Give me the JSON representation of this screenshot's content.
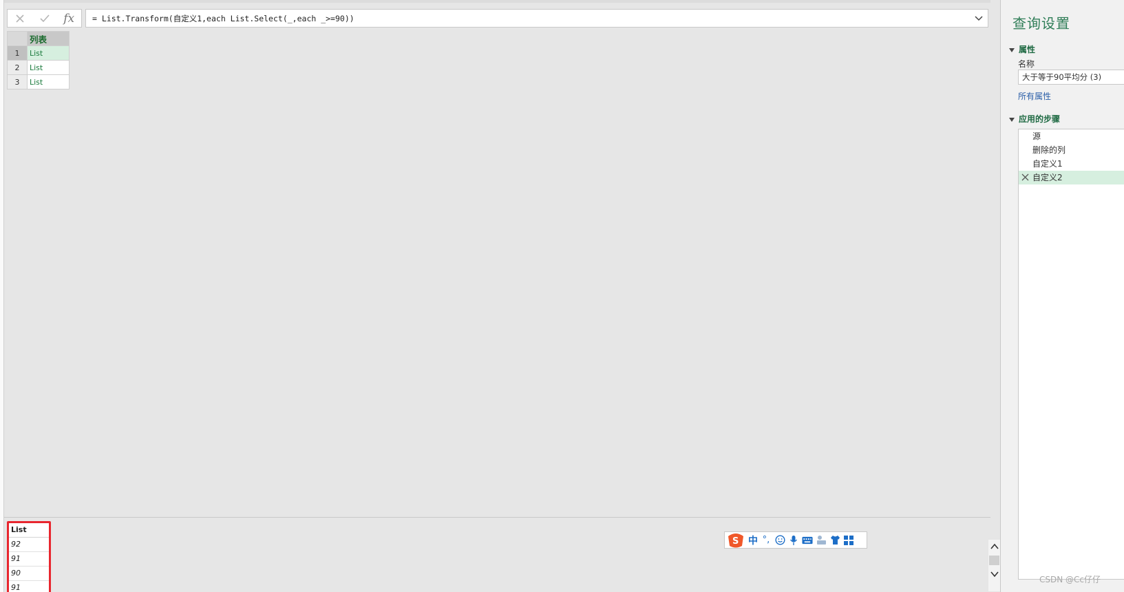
{
  "formula_bar": {
    "cancel_icon": "close-icon",
    "confirm_icon": "check-icon",
    "fx_label": "fx",
    "formula": "= List.Transform(自定义1,each List.Select(_,each _>=90))"
  },
  "grid": {
    "column_header": "列表",
    "rows": [
      {
        "num": "1",
        "value": "List"
      },
      {
        "num": "2",
        "value": "List"
      },
      {
        "num": "3",
        "value": "List"
      }
    ]
  },
  "preview": {
    "header": "List",
    "values": [
      "92",
      "91",
      "90",
      "91"
    ]
  },
  "ime": {
    "zh_label": "中",
    "punct_label": "°,"
  },
  "query_settings": {
    "title": "查询设置",
    "properties_label": "属性",
    "name_label": "名称",
    "name_value": "大于等于90平均分 (3)",
    "all_properties_link": "所有属性",
    "applied_steps_label": "应用的步骤",
    "steps": [
      "源",
      "删除的列",
      "自定义1",
      "自定义2"
    ],
    "selected_step": "自定义2"
  },
  "watermark": "CSDN @Cc仔仔",
  "colors": {
    "accent_green": "#1f6a43",
    "highlight_red": "#e8262e",
    "selection_green": "#d6efdf"
  }
}
